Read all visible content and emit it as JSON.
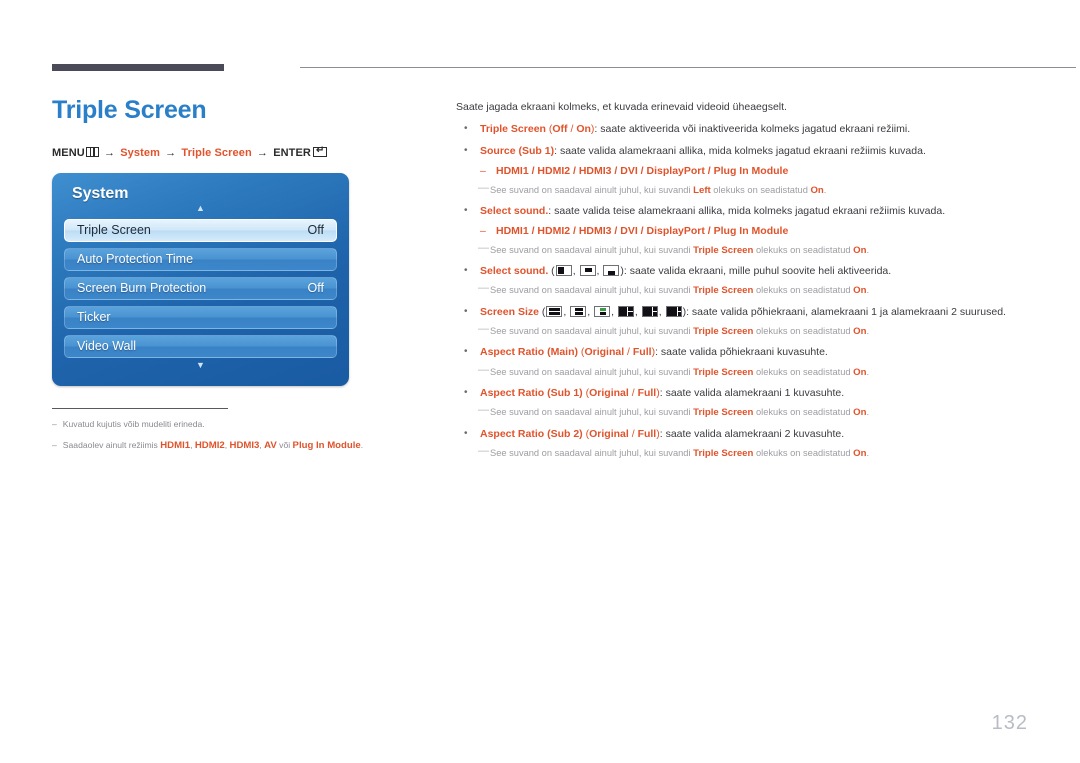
{
  "page_title": "Triple Screen",
  "menu_path": {
    "menu_label": "MENU",
    "arrow": "→",
    "system": "System",
    "triple_screen": "Triple Screen",
    "enter_label": "ENTER"
  },
  "osd": {
    "title": "System",
    "up_arrow": "▲",
    "down_arrow": "▼",
    "rows": [
      {
        "label": "Triple Screen",
        "value": "Off",
        "selected": true
      },
      {
        "label": "Auto Protection Time",
        "value": "",
        "selected": false
      },
      {
        "label": "Screen Burn Protection",
        "value": "Off",
        "selected": false
      },
      {
        "label": "Ticker",
        "value": "",
        "selected": false
      },
      {
        "label": "Video Wall",
        "value": "",
        "selected": false
      }
    ]
  },
  "left_notes": [
    {
      "mark": "–",
      "text": "Kuvatud kujutis võib mudeliti erineda."
    },
    {
      "mark": "–",
      "prefix": "Saadaolev ainult režiimis ",
      "bold_1": "HDMI1",
      "sep_1": ", ",
      "bold_2": "HDMI2",
      "sep_2": ", ",
      "bold_3": "HDMI3",
      "sep_3": ", ",
      "bold_4": "AV",
      "sep_4": " või ",
      "bold_5": "Plug In Module",
      "suffix": "."
    }
  ],
  "content": {
    "lead": "Saate jagada ekraani kolmeks, et kuvada erinevaid videoid üheaegselt.",
    "bullet_mark": "•",
    "dash_mark": "–",
    "note_mark": "—",
    "items": [
      {
        "kind": "bullet",
        "term": "Triple Screen",
        "options_open": " (",
        "opt_a": "Off",
        "opt_sep": " / ",
        "opt_b": "On",
        "options_close": ")",
        "desc": ": saate aktiveerida või inaktiveerida kolmeks jagatud ekraani režiimi."
      },
      {
        "kind": "bullet",
        "term": "Source (Sub 1)",
        "desc": ": saate valida alamekraani allika, mida kolmeks jagatud ekraani režiimis kuvada."
      },
      {
        "kind": "dash",
        "text": "HDMI1 / HDMI2 / HDMI3 / DVI / DisplayPort / Plug In Module"
      },
      {
        "kind": "note",
        "pre": "See suvand on saadaval ainult juhul, kui suvandi ",
        "term": "Left",
        "mid": " olekuks on seadistatud ",
        "state": "On",
        "post": "."
      },
      {
        "kind": "bullet",
        "term": "Select sound.",
        "desc": ": saate valida teise alamekraani allika, mida kolmeks jagatud ekraani režiimis kuvada."
      },
      {
        "kind": "dash",
        "text": "HDMI1 / HDMI2 / HDMI3 / DVI / DisplayPort / Plug In Module"
      },
      {
        "kind": "note",
        "pre": "See suvand on saadaval ainult juhul, kui suvandi ",
        "term": "Triple Screen",
        "mid": " olekuks on seadistatud ",
        "state": "On",
        "post": "."
      },
      {
        "kind": "bullet-icons-sound",
        "term": "Select sound.",
        "open": " (",
        "sep": ", ",
        "close": ")",
        "desc": ": saate valida ekraani, mille puhul soovite heli aktiveerida.",
        "icons": [
          "screen-left-highlight-icon",
          "screen-top-highlight-icon",
          "screen-bottom-highlight-icon"
        ]
      },
      {
        "kind": "note",
        "pre": "See suvand on saadaval ainult juhul, kui suvandi ",
        "term": "Triple Screen",
        "mid": " olekuks on seadistatud ",
        "state": "On",
        "post": "."
      },
      {
        "kind": "bullet-icons-size",
        "term": "Screen Size",
        "open": " (",
        "sep": ", ",
        "close": ")",
        "desc": ": saate valida põhiekraani, alamekraani 1 ja alamekraani 2 suurused.",
        "icons": [
          "split-horizontal-even-icon",
          "split-horizontal-narrow-icon",
          "split-horizontal-small-icon",
          "split-main-left-wide-icon",
          "split-main-left-wider-icon",
          "split-main-left-widest-icon"
        ]
      },
      {
        "kind": "note",
        "pre": "See suvand on saadaval ainult juhul, kui suvandi ",
        "term": "Triple Screen",
        "mid": " olekuks on seadistatud ",
        "state": "On",
        "post": "."
      },
      {
        "kind": "bullet",
        "term": "Aspect Ratio (Main)",
        "options_open": " (",
        "opt_a": "Original",
        "opt_sep": " / ",
        "opt_b": "Full",
        "options_close": ")",
        "desc": ": saate valida põhiekraani kuvasuhte."
      },
      {
        "kind": "note",
        "pre": "See suvand on saadaval ainult juhul, kui suvandi ",
        "term": "Triple Screen",
        "mid": " olekuks on seadistatud ",
        "state": "On",
        "post": "."
      },
      {
        "kind": "bullet",
        "term": "Aspect Ratio (Sub 1)",
        "options_open": " (",
        "opt_a": "Original",
        "opt_sep": " / ",
        "opt_b": "Full",
        "options_close": ")",
        "desc": ": saate valida alamekraani 1 kuvasuhte."
      },
      {
        "kind": "note",
        "pre": "See suvand on saadaval ainult juhul, kui suvandi ",
        "term": "Triple Screen",
        "mid": " olekuks on seadistatud ",
        "state": "On",
        "post": "."
      },
      {
        "kind": "bullet",
        "term": "Aspect Ratio (Sub 2)",
        "options_open": " (",
        "opt_a": "Original",
        "opt_sep": " / ",
        "opt_b": "Full",
        "options_close": ")",
        "desc": ": saate valida alamekraani 2 kuvasuhte."
      },
      {
        "kind": "note",
        "pre": "See suvand on saadaval ainult juhul, kui suvandi ",
        "term": "Triple Screen",
        "mid": " olekuks on seadistatud ",
        "state": "On",
        "post": "."
      }
    ]
  },
  "page_number": "132",
  "colors": {
    "title_blue": "#2a7fc9",
    "accent_orange": "#e0532c",
    "body_gray": "#3b3b40",
    "note_gray": "#9d9da3",
    "osd_blue_dark": "#1a5ba2",
    "osd_blue_light": "#3f8fd0"
  }
}
